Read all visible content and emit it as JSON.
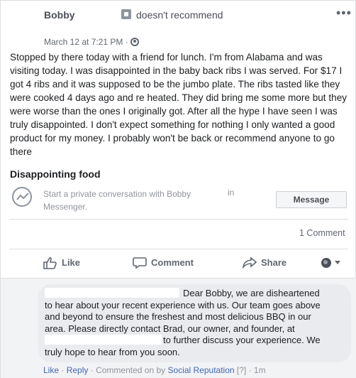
{
  "post": {
    "author": "Bobby",
    "recommendation": "doesn't recommend",
    "date": "March 12 at 7:21 PM",
    "date_separator": "·",
    "more_icon": "ellipsis-icon",
    "body": "Stopped by there today with a friend for lunch. I'm from Alabama and was visiting today. I was disappointed in the baby back ribs I was served. For $17 I got 4 ribs and it was supposed to be the jumbo plate. The ribs tasted like they were cooked 4 days ago and re heated. They did bring me some more but they were worse than the ones I originally got. After all the hype I have seen I was truly disappointed. I don't expect something for nothing I only wanted a good product for my money. I probably won't be back or recommend anyone to go there",
    "headline": "Disappointing food"
  },
  "messenger": {
    "prompt": "Start a private conversation with Bobby",
    "prompt_end": "Messenger.",
    "in_label": "in",
    "button_label": "Message"
  },
  "stats": {
    "comment_count": "1 Comment"
  },
  "actions": {
    "like": "Like",
    "comment": "Comment",
    "share": "Share"
  },
  "reply": {
    "lines": [
      "Dear Bobby, we are disheartened",
      "to hear about your recent experience with us. Our team goes above",
      "and beyond to ensure the freshest and most delicious BBQ in our",
      "area. Please directly contact Brad, our owner, and founder, at",
      "to further discuss your experience. We",
      "truly hope to hear from you soon."
    ],
    "meta": {
      "like": "Like",
      "dot": "·",
      "reply": "Reply",
      "commented_on_by": "Commented on by",
      "page": "Social Reputation",
      "help": "[?]",
      "time": "1m"
    }
  },
  "colors": {
    "link": "#4267b2",
    "muted": "#90949c",
    "text": "#1c1e21",
    "bubble": "#e9ebee"
  }
}
